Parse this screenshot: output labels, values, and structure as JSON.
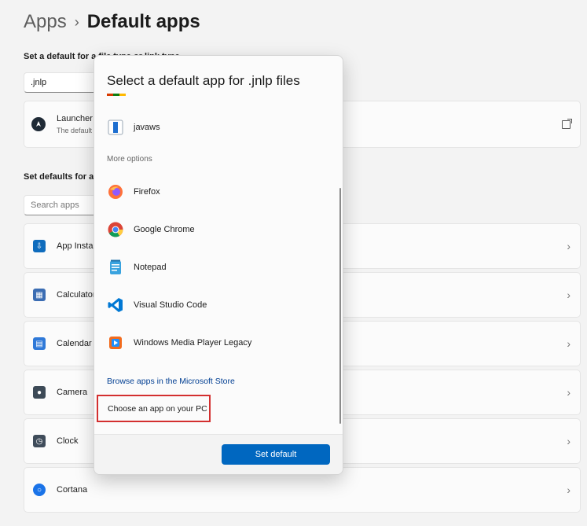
{
  "breadcrumb": {
    "parent": "Apps",
    "separator": "›",
    "current": "Default apps"
  },
  "file_type_section": {
    "label": "Set a default for a file type or link type",
    "input_value": ".jnlp",
    "launcher_title": "Launcher f",
    "launcher_subtitle": "The default"
  },
  "apps_section": {
    "label": "Set defaults for app",
    "search_placeholder": "Search apps",
    "items": [
      {
        "label": "App Install",
        "icon": "app-installer-icon",
        "color": "#0f6cbd"
      },
      {
        "label": "Calculator",
        "icon": "calculator-icon",
        "color": "#3b6db3"
      },
      {
        "label": "Calendar",
        "icon": "calendar-icon",
        "color": "#2f79d8"
      },
      {
        "label": "Camera",
        "icon": "camera-icon",
        "color": "#3d4a57"
      },
      {
        "label": "Clock",
        "icon": "clock-icon",
        "color": "#3f4c5a"
      },
      {
        "label": "Cortana",
        "icon": "cortana-icon",
        "color": "#1a73e8"
      }
    ]
  },
  "dialog": {
    "title": "Select a default app for .jnlp files",
    "current_app": "javaws",
    "more_options": "More options",
    "options": [
      {
        "label": "Firefox",
        "icon": "firefox-icon"
      },
      {
        "label": "Google Chrome",
        "icon": "chrome-icon"
      },
      {
        "label": "Notepad",
        "icon": "notepad-icon"
      },
      {
        "label": "Visual Studio Code",
        "icon": "vscode-icon"
      },
      {
        "label": "Windows Media Player Legacy",
        "icon": "media-player-icon"
      }
    ],
    "browse_store": "Browse apps in the Microsoft Store",
    "choose_pc": "Choose an app on your PC",
    "set_default": "Set default"
  },
  "colors": {
    "accent": "#0067c0",
    "highlight_border": "#d32f2f",
    "link": "#003e92"
  }
}
